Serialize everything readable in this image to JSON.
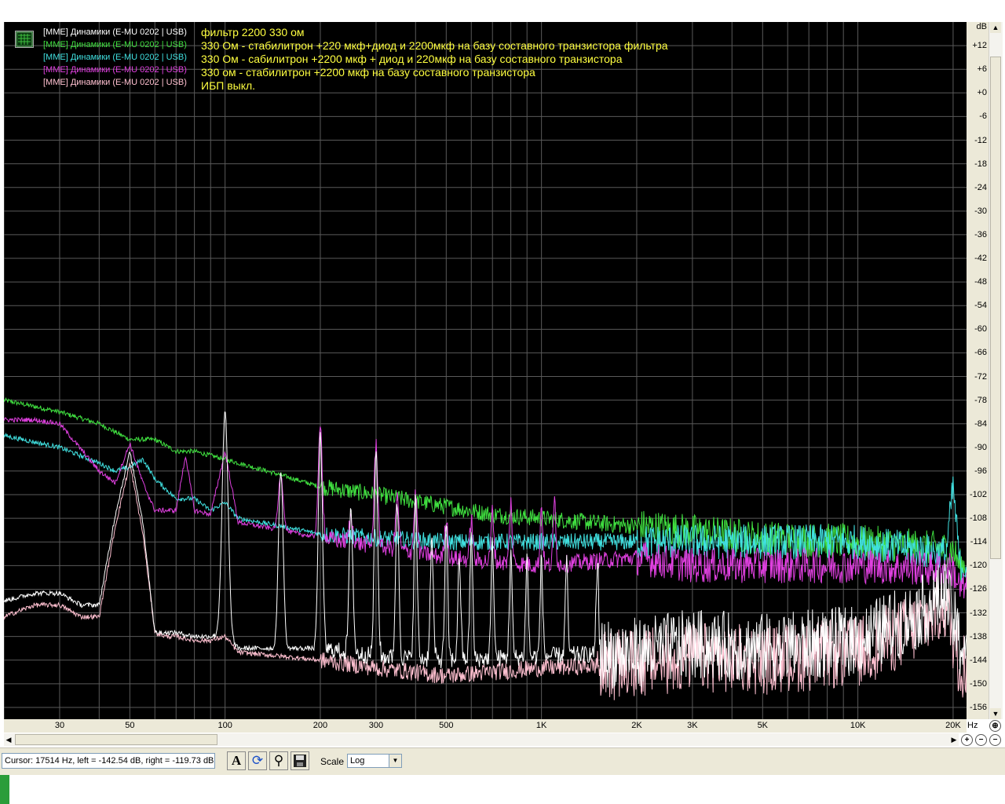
{
  "legend": {
    "icon": "spectrum-icon",
    "items": [
      {
        "device": "[MME] Динамики (E-MU 0202 | USB)",
        "description": "фильтр 2200 330 ом",
        "color": "#ffffff"
      },
      {
        "device": "[MME] Динамики (E-MU 0202 | USB)",
        "description": "330 Ом - стабилитрон +220 мкф+диод и 2200мкф на базу составного транзистора фильтра",
        "color": "#40e040"
      },
      {
        "device": "[MME] Динамики (E-MU 0202 | USB)",
        "description": "330 Ом - сабилитрон +2200 мкф + диод и 220мкф на базу составного транзистора",
        "color": "#40e0e0"
      },
      {
        "device": "[MME] Динамики (E-MU 0202 | USB)",
        "description": "330 ом - стабилитрон +2200 мкф на базу составного транзистора",
        "color": "#e040e0"
      },
      {
        "device": "[MME] Динамики (E-MU 0202 | USB)",
        "description": "ИБП выкл.",
        "color": "#ffc0d0"
      }
    ]
  },
  "chart_data": {
    "type": "line",
    "xscale": "log",
    "xlim": [
      20,
      22050
    ],
    "ylim": [
      -159,
      18
    ],
    "grid": true,
    "x_unit": "Hz",
    "y_unit": "dB",
    "x_ticks": [
      {
        "v": 30,
        "label": "30"
      },
      {
        "v": 50,
        "label": "50"
      },
      {
        "v": 100,
        "label": "100"
      },
      {
        "v": 200,
        "label": "200"
      },
      {
        "v": 300,
        "label": "300"
      },
      {
        "v": 500,
        "label": "500"
      },
      {
        "v": 1000,
        "label": "1K"
      },
      {
        "v": 2000,
        "label": "2K"
      },
      {
        "v": 3000,
        "label": "3K"
      },
      {
        "v": 5000,
        "label": "5K"
      },
      {
        "v": 10000,
        "label": "10K"
      },
      {
        "v": 20000,
        "label": "20K"
      }
    ],
    "y_ticks": [
      12,
      6,
      0,
      -6,
      -12,
      -18,
      -24,
      -30,
      -36,
      -42,
      -48,
      -54,
      -60,
      -66,
      -72,
      -78,
      -84,
      -90,
      -96,
      -102,
      -108,
      -114,
      -120,
      -126,
      -132,
      -138,
      -144,
      -150,
      -156
    ],
    "y_tick_labels": [
      "+12",
      "+6",
      "+0",
      "-6",
      "-12",
      "-18",
      "-24",
      "-30",
      "-36",
      "-42",
      "-48",
      "-54",
      "-60",
      "-66",
      "-72",
      "-78",
      "-84",
      "-90",
      "-96",
      "-102",
      "-108",
      "-114",
      "-120",
      "-126",
      "-132",
      "-138",
      "-144",
      "-150",
      "-156"
    ],
    "series": [
      {
        "color": "#40e040",
        "x": [
          20,
          30,
          40,
          50,
          60,
          70,
          80,
          100,
          150,
          200,
          300,
          500,
          700,
          1000,
          2000,
          5000,
          10000,
          20000,
          21000
        ],
        "y": [
          -78,
          -81,
          -84,
          -88,
          -88,
          -91,
          -91,
          -93,
          -97,
          -100,
          -102,
          -105,
          -107,
          -108,
          -110,
          -113,
          -114,
          -116,
          -120
        ],
        "peaks": []
      },
      {
        "color": "#40e0e0",
        "x": [
          20,
          30,
          40,
          45,
          50,
          55,
          60,
          70,
          80,
          90,
          100,
          110,
          150,
          200,
          300,
          500,
          1000,
          2000,
          5000,
          10000,
          19000,
          20000,
          21000
        ],
        "y": [
          -87,
          -90,
          -94,
          -96,
          -95,
          -93,
          -98,
          -103,
          -103,
          -106,
          -104,
          -108,
          -110,
          -112,
          -113,
          -114,
          -114,
          -114,
          -114,
          -114,
          -117,
          -100,
          -120
        ],
        "peaks": []
      },
      {
        "color": "#e040e0",
        "x": [
          20,
          25,
          30,
          40,
          45,
          50,
          55,
          60,
          70,
          75,
          80,
          90,
          100,
          110,
          150,
          200,
          300,
          500,
          1000,
          2000,
          3000,
          5000,
          10000,
          20000,
          21000
        ],
        "y": [
          -83,
          -83,
          -84,
          -96,
          -99,
          -89,
          -99,
          -106,
          -106,
          -92,
          -106,
          -107,
          -91,
          -109,
          -111,
          -113,
          -115,
          -118,
          -120,
          -118,
          -120,
          -120,
          -120,
          -121,
          -126
        ],
        "peaks": [
          {
            "f": 150,
            "db": -97
          },
          {
            "f": 200,
            "db": -85
          },
          {
            "f": 250,
            "db": -108
          },
          {
            "f": 300,
            "db": -89
          },
          {
            "f": 350,
            "db": -103
          },
          {
            "f": 400,
            "db": -102
          },
          {
            "f": 500,
            "db": -108
          },
          {
            "f": 600,
            "db": -108
          },
          {
            "f": 700,
            "db": -106
          },
          {
            "f": 800,
            "db": -104
          },
          {
            "f": 1000,
            "db": -105
          },
          {
            "f": 1100,
            "db": -103
          }
        ]
      },
      {
        "color": "#ffc0d0",
        "x": [
          20,
          25,
          30,
          35,
          40,
          45,
          50,
          55,
          60,
          65,
          70,
          80,
          90,
          100,
          110,
          150,
          200,
          300,
          500,
          1000,
          2000,
          3000,
          5000,
          10000,
          15000,
          19000,
          21000
        ],
        "y": [
          -133,
          -130,
          -130,
          -133,
          -133,
          -110,
          -94,
          -112,
          -137,
          -138,
          -138,
          -139,
          -139,
          -138,
          -142,
          -143,
          -144,
          -146,
          -148,
          -146,
          -145,
          -143,
          -144,
          -142,
          -136,
          -130,
          -145
        ],
        "peaks": []
      },
      {
        "color": "#ffffff",
        "x": [
          20,
          25,
          30,
          35,
          40,
          45,
          50,
          55,
          60,
          65,
          70,
          80,
          90,
          100,
          110,
          150,
          200,
          300,
          500,
          1000,
          2000,
          3000,
          5000,
          10000,
          15000,
          19000,
          21000
        ],
        "y": [
          -129,
          -127,
          -127,
          -130,
          -130,
          -107,
          -91,
          -109,
          -137,
          -137,
          -137,
          -138,
          -138,
          -137,
          -141,
          -141,
          -141,
          -143,
          -144,
          -143,
          -142,
          -140,
          -141,
          -139,
          -133,
          -127,
          -140
        ],
        "peaks": [
          {
            "f": 100,
            "db": -81
          },
          {
            "f": 150,
            "db": -96
          },
          {
            "f": 200,
            "db": -86
          },
          {
            "f": 250,
            "db": -106
          },
          {
            "f": 300,
            "db": -90
          },
          {
            "f": 350,
            "db": -104
          },
          {
            "f": 400,
            "db": -103
          },
          {
            "f": 450,
            "db": -114
          },
          {
            "f": 500,
            "db": -110
          },
          {
            "f": 550,
            "db": -118
          },
          {
            "f": 600,
            "db": -112
          },
          {
            "f": 700,
            "db": -114
          },
          {
            "f": 800,
            "db": -116
          },
          {
            "f": 900,
            "db": -118
          },
          {
            "f": 1000,
            "db": -118
          },
          {
            "f": 1200,
            "db": -119
          },
          {
            "f": 1500,
            "db": -122
          }
        ]
      }
    ]
  },
  "status": {
    "cursor": "Cursor:  17514 Hz,  left = -142.54 dB,  right = -119.73 dB",
    "scale_label": "Scale",
    "scale_value": "Log"
  },
  "axis_labels": {
    "y_unit": "dB",
    "x_unit": "Hz"
  }
}
